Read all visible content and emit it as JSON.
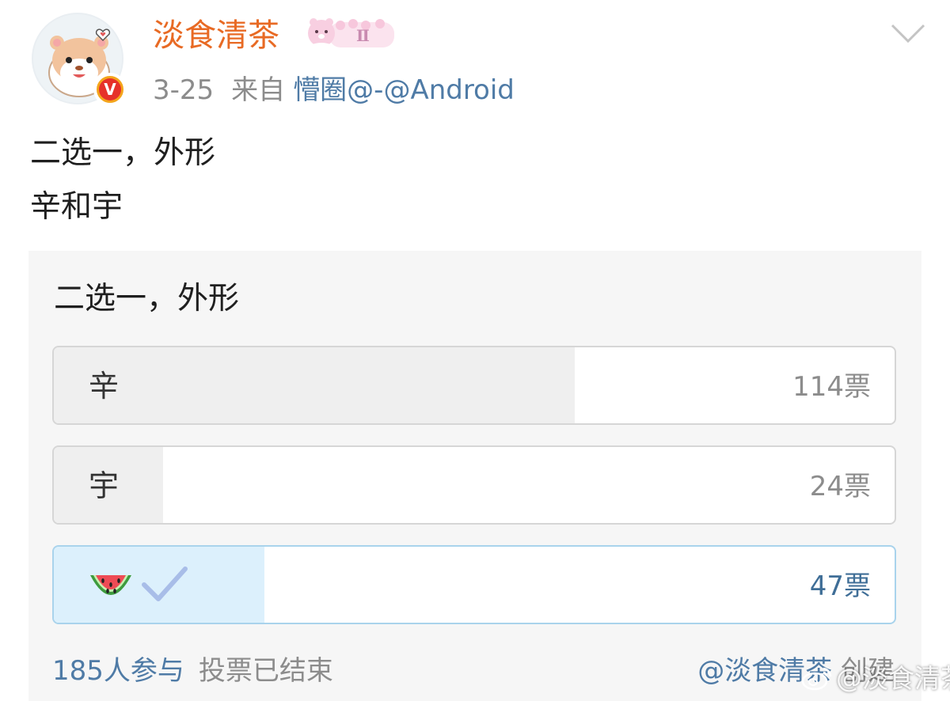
{
  "post": {
    "username": "淡食清茶",
    "date": "3-25",
    "source_prefix": "来自",
    "source": "懵圈@-@Android",
    "content_line1": "二选一，外形",
    "content_line2": "辛和宇"
  },
  "poll": {
    "title": "二选一，外形",
    "options": [
      {
        "label": "辛",
        "votes": "114票",
        "share": 0.62
      },
      {
        "label": "宇",
        "votes": "24票",
        "share": 0.13
      },
      {
        "label": "watermelon-emoji",
        "votes": "47票",
        "share": 0.25,
        "selected": true
      }
    ],
    "participants": "185人参与",
    "status": "投票已结束",
    "creator_handle": "@淡食清茶",
    "creator_suffix": " 创建"
  },
  "watermark": "@淡食清茶",
  "icons": {
    "avatar": "hamster-avatar",
    "verified": "verified-v-badge",
    "member": "member-level-badge",
    "more": "chevron-down-icon",
    "selected": "check-icon"
  },
  "colors": {
    "username": "#e86a24",
    "link": "#4f7ba6",
    "muted": "#8c8c8c",
    "selected_fill": "#dcf0fc",
    "selected_border": "#a9d3ec"
  }
}
